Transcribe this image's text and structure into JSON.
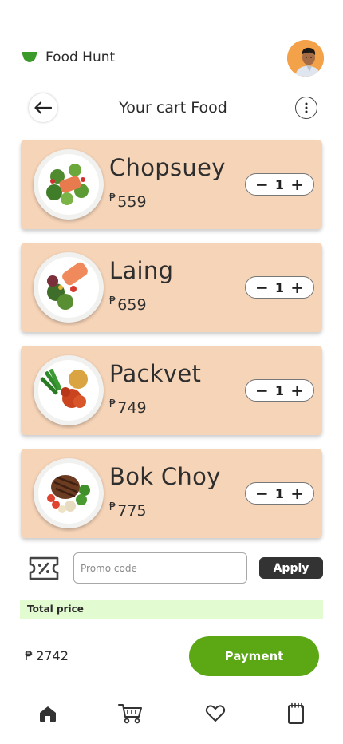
{
  "app": {
    "name": "Food Hunt",
    "brand_color": "#3a9a2a"
  },
  "header": {
    "title": "Your cart Food"
  },
  "currency_symbol": "₱",
  "cart": {
    "items": [
      {
        "name": "Chopsuey",
        "price": "559",
        "qty": "1"
      },
      {
        "name": "Laing",
        "price": "659",
        "qty": "1"
      },
      {
        "name": "Packvet",
        "price": "749",
        "qty": "1"
      },
      {
        "name": "Bok Choy",
        "price": "775",
        "qty": "1"
      }
    ],
    "card_color": "#f6d4b8"
  },
  "promo": {
    "placeholder": "Promo code",
    "value": "",
    "apply_label": "Apply"
  },
  "total": {
    "label": "Total price",
    "amount": "2742"
  },
  "payment": {
    "label": "Payment",
    "color": "#5ca714"
  },
  "nav": {
    "items": [
      {
        "icon": "home-icon",
        "active": true
      },
      {
        "icon": "cart-icon",
        "active": false
      },
      {
        "icon": "heart-icon",
        "active": false
      },
      {
        "icon": "notepad-icon",
        "active": false
      }
    ]
  }
}
